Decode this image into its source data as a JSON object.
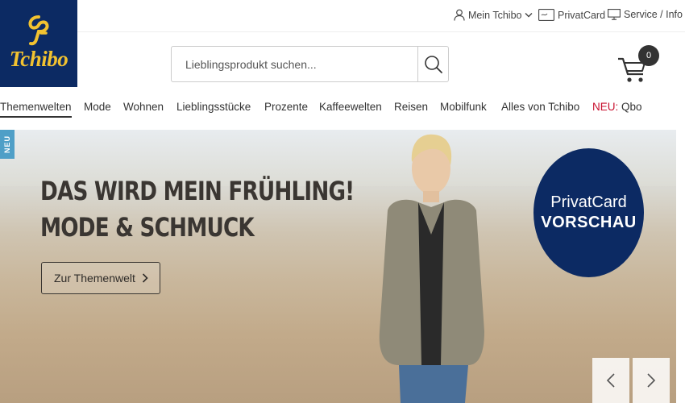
{
  "brand": {
    "name": "Tchibo"
  },
  "utility": {
    "account_label": "Mein Tchibo",
    "privatcard_label": "PrivatCard",
    "service_label": "Service / Info"
  },
  "search": {
    "placeholder": "Lieblingsprodukt suchen..."
  },
  "cart": {
    "count": "0"
  },
  "nav": {
    "items": [
      "Themenwelten",
      "Mode",
      "Wohnen",
      "Lieblingsstücke",
      "Prozente",
      "Kaffeewelten",
      "Reisen",
      "Mobilfunk",
      "Alles von Tchibo"
    ],
    "new_prefix": "NEU:",
    "new_item": "Qbo",
    "active": "Themenwelten"
  },
  "hero": {
    "tag": "NEU",
    "headline_line1": "DAS WIRD MEIN FRÜHLING!",
    "headline_line2": "MODE & SCHMUCK",
    "cta_label": "Zur Themenwelt",
    "badge_line1": "PrivatCard",
    "badge_line2": "VORSCHAU"
  },
  "colors": {
    "brand_navy": "#0c2a63",
    "brand_gold": "#f2c230",
    "new_red": "#c8102e",
    "tag_blue": "#4f9fc7"
  },
  "icons": [
    "user-icon",
    "chevron-down-icon",
    "privatcard-icon",
    "monitor-icon",
    "search-icon",
    "cart-icon",
    "chevron-right-icon",
    "chevron-left-icon"
  ]
}
